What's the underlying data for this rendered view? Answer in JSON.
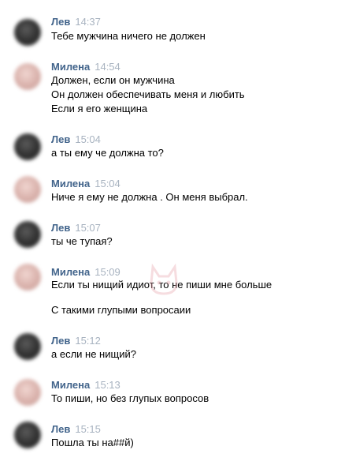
{
  "colors": {
    "author": "#42648b",
    "time": "#a8b3c0",
    "text": "#000000",
    "background": "#ffffff",
    "watermark": "#e8a0a8"
  },
  "watermark": {
    "icon": "cat-logo-icon"
  },
  "messages": [
    {
      "author": "Лев",
      "time": "14:37",
      "avatar": "lev",
      "lines": [
        "Тебе мужчина ничего не должен"
      ]
    },
    {
      "author": "Милена",
      "time": "14:54",
      "avatar": "milena",
      "lines": [
        "Должен, если он мужчина",
        "Он должен обеспечивать меня и любить",
        "Если я его женщина"
      ]
    },
    {
      "author": "Лев",
      "time": "15:04",
      "avatar": "lev",
      "lines": [
        "а ты ему че должна то?"
      ]
    },
    {
      "author": "Милена",
      "time": "15:04",
      "avatar": "milena",
      "lines": [
        "Ниче я ему не должна . Он меня выбрал."
      ]
    },
    {
      "author": "Лев",
      "time": "15:07",
      "avatar": "lev",
      "lines": [
        "ты че тупая?"
      ]
    },
    {
      "author": "Милена",
      "time": "15:09",
      "avatar": "milena",
      "lines": [
        "Если ты нищий идиот, то не пиши мне больше",
        "С такими глупыми вопросаии"
      ]
    },
    {
      "author": "Лев",
      "time": "15:12",
      "avatar": "lev",
      "lines": [
        "а если не нищий?"
      ]
    },
    {
      "author": "Милена",
      "time": "15:13",
      "avatar": "milena",
      "lines": [
        "То пиши, но без глупых вопросов"
      ]
    },
    {
      "author": "Лев",
      "time": "15:15",
      "avatar": "lev",
      "lines": [
        "Пошла ты на##й)"
      ]
    }
  ]
}
